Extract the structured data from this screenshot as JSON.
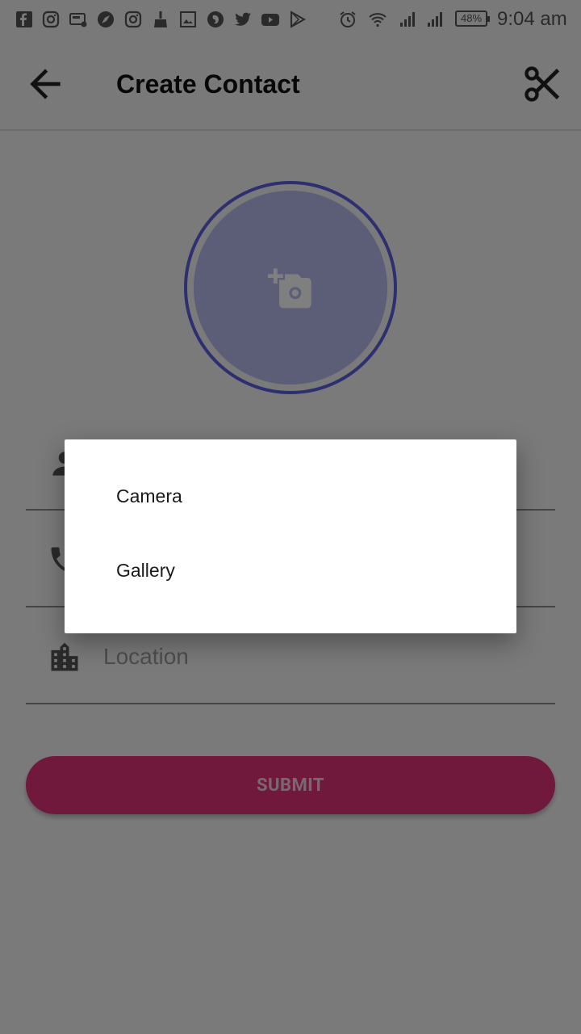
{
  "status_bar": {
    "notification_icons": [
      "facebook-icon",
      "instagram-icon",
      "screenshot-icon",
      "compass-icon",
      "instagram-icon",
      "broom-icon",
      "image-icon",
      "firefox-icon",
      "twitter-icon",
      "youtube-icon",
      "play-store-icon"
    ],
    "system_icons": [
      "alarm-icon",
      "wifi-icon",
      "signal-icon",
      "signal-icon"
    ],
    "battery": "48%",
    "time": "9:04 am"
  },
  "app_bar": {
    "back_icon": "arrow-back-icon",
    "title": "Create Contact",
    "action_icon": "scissors-icon"
  },
  "form": {
    "photo_icon": "add-a-photo-icon",
    "fields": [
      {
        "icon": "person-icon",
        "placeholder": ""
      },
      {
        "icon": "phone-icon",
        "placeholder": ""
      },
      {
        "icon": "location-city-icon",
        "placeholder": "Location"
      }
    ],
    "submit_label": "SUBMIT"
  },
  "dialog": {
    "options": [
      "Camera",
      "Gallery"
    ]
  },
  "colors": {
    "accent_ring": "#5c5fe0",
    "avatar_fill": "#b8bdf1",
    "submit_bg": "#e0337b",
    "scrim": "rgba(0,0,0,0.5)"
  }
}
